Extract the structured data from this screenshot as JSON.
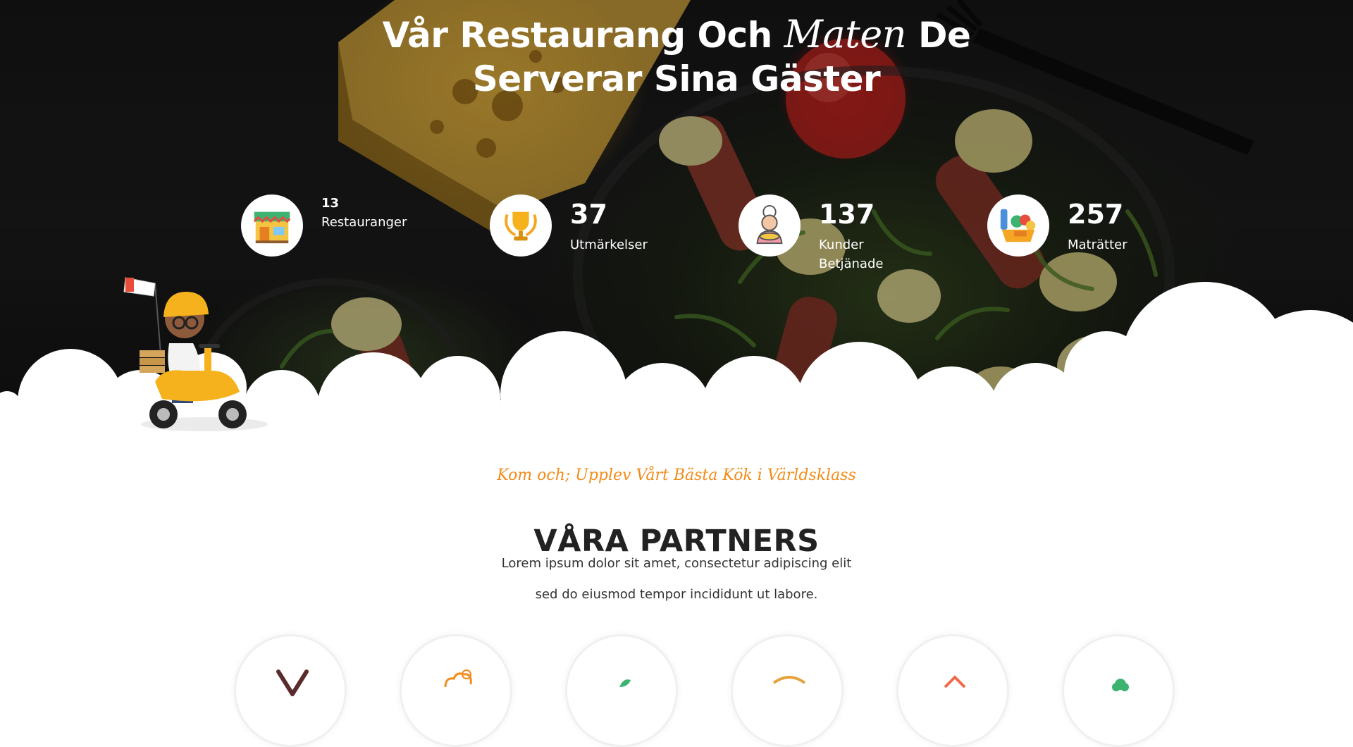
{
  "hero": {
    "title_line1_start": "Vår Restaurang Och",
    "title_script": "Maten",
    "title_line1_end": "De",
    "title_line2": "Serverar Sina Gäster"
  },
  "stats": [
    {
      "number": "13",
      "label": "Restauranger",
      "icon": "restaurant-storefront-icon"
    },
    {
      "number": "37",
      "label": "Utmärkelser",
      "icon": "trophy-icon"
    },
    {
      "number": "137",
      "label": "Kunder Betjänade",
      "icon": "chef-icon"
    },
    {
      "number": "257",
      "label": "Maträtter",
      "icon": "food-basket-icon"
    }
  ],
  "partners_section": {
    "kicker": "Kom och; Upplev Vårt Bästa Kök i Världsklass",
    "title": "VÅRA PARTNERS",
    "description_line1": "Lorem ipsum dolor sit amet, consectetur adipiscing elit",
    "description_line2": "sed do eiusmod tempor incididunt ut labore."
  },
  "partner_logos": [
    "utensils-logo-icon",
    "chef-hat-logo-icon",
    "leaf-logo-icon",
    "restaurant-badge-logo-icon",
    "house-logo-icon",
    "broccoli-logo-icon"
  ],
  "colors": {
    "accent": "#f28c1b",
    "heading": "#222222",
    "hero_text": "#ffffff",
    "scooter": "#f5b21d"
  }
}
